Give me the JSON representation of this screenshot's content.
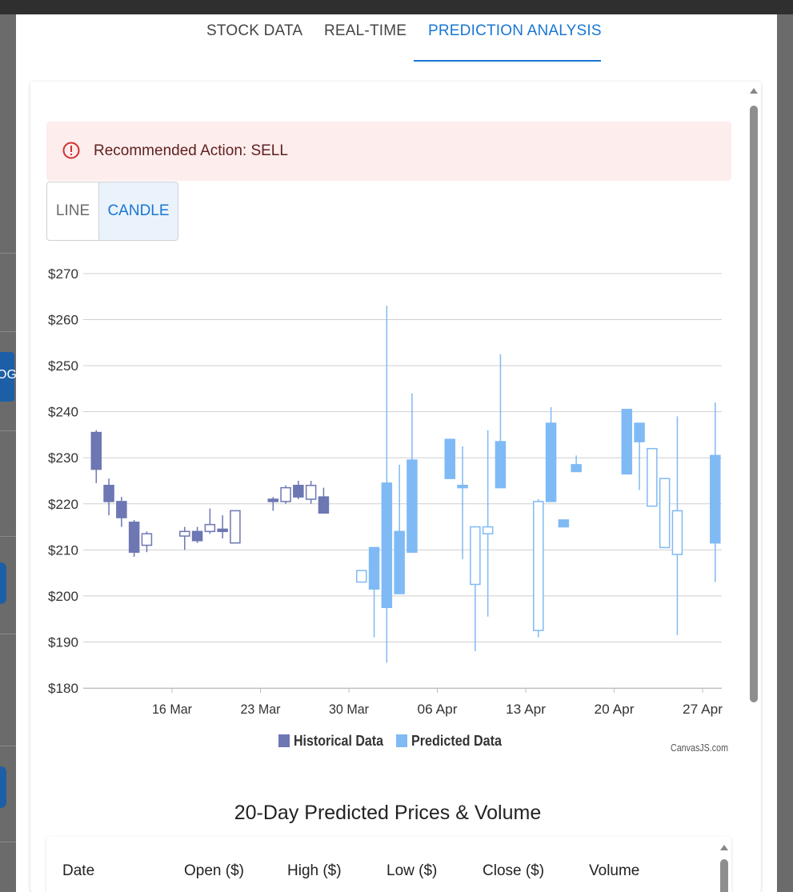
{
  "tabs": [
    {
      "label": "STOCK DATA"
    },
    {
      "label": "REAL-TIME"
    },
    {
      "label": "PREDICTION ANALYSIS"
    }
  ],
  "alert": {
    "text": "Recommended Action: SELL",
    "icon": "error-outline-icon"
  },
  "chart_toggle": {
    "line_label": "LINE",
    "candle_label": "CANDLE",
    "selected": "CANDLE"
  },
  "background": {
    "partial_text": "OG"
  },
  "colors": {
    "historical": "#6d77b3",
    "predicted": "#7fbaf5",
    "accent": "#1976d2",
    "alert_bg": "#fdeded"
  },
  "chart_data": {
    "type": "candlestick",
    "ylim": [
      180,
      270
    ],
    "y_ticks": [
      "$270",
      "$260",
      "$250",
      "$240",
      "$230",
      "$220",
      "$210",
      "$200",
      "$190",
      "$180"
    ],
    "y_tick_values": [
      270,
      260,
      250,
      240,
      230,
      220,
      210,
      200,
      190,
      180
    ],
    "x_ticks": [
      "16 Mar",
      "23 Mar",
      "30 Mar",
      "06 Apr",
      "13 Apr",
      "20 Apr",
      "27 Apr"
    ],
    "x_tick_dates": [
      "2025-03-16",
      "2025-03-23",
      "2025-03-30",
      "2025-04-06",
      "2025-04-13",
      "2025-04-20",
      "2025-04-27"
    ],
    "xlim": [
      "2025-03-09",
      "2025-04-28"
    ],
    "grid": true,
    "legend": "bottom-center",
    "credit": "CanvasJS.com",
    "series": [
      {
        "name": "Historical Data",
        "color": "#6d77b3",
        "points": [
          {
            "date": "2025-03-10",
            "open": 235.5,
            "high": 236,
            "low": 224.5,
            "close": 227.5
          },
          {
            "date": "2025-03-11",
            "open": 224,
            "high": 225.5,
            "low": 217.5,
            "close": 220.5
          },
          {
            "date": "2025-03-12",
            "open": 220.5,
            "high": 221.5,
            "low": 215,
            "close": 217
          },
          {
            "date": "2025-03-13",
            "open": 216,
            "high": 216.5,
            "low": 208.5,
            "close": 209.5
          },
          {
            "date": "2025-03-14",
            "open": 211,
            "high": 214,
            "low": 209.5,
            "close": 213.5
          },
          {
            "date": "2025-03-17",
            "open": 213,
            "high": 215,
            "low": 210,
            "close": 214
          },
          {
            "date": "2025-03-18",
            "open": 214,
            "high": 215,
            "low": 211.5,
            "close": 212
          },
          {
            "date": "2025-03-19",
            "open": 214,
            "high": 219,
            "low": 213.5,
            "close": 215.5
          },
          {
            "date": "2025-03-20",
            "open": 214.5,
            "high": 217.5,
            "low": 212.5,
            "close": 214
          },
          {
            "date": "2025-03-21",
            "open": 211.5,
            "high": 218.5,
            "low": 211.5,
            "close": 218.5
          },
          {
            "date": "2025-03-24",
            "open": 221,
            "high": 221.5,
            "low": 218.5,
            "close": 220.5
          },
          {
            "date": "2025-03-25",
            "open": 220.5,
            "high": 224,
            "low": 220,
            "close": 223.5
          },
          {
            "date": "2025-03-26",
            "open": 224,
            "high": 225,
            "low": 221,
            "close": 221.5
          },
          {
            "date": "2025-03-27",
            "open": 221,
            "high": 225,
            "low": 220,
            "close": 224
          },
          {
            "date": "2025-03-28",
            "open": 221.5,
            "high": 223.5,
            "low": 218,
            "close": 218
          }
        ]
      },
      {
        "name": "Predicted Data",
        "color": "#7fbaf5",
        "points": [
          {
            "date": "2025-03-31",
            "open": 203,
            "high": 205.5,
            "low": 203,
            "close": 205.5
          },
          {
            "date": "2025-04-01",
            "open": 210.5,
            "high": 210.5,
            "low": 191,
            "close": 201.5
          },
          {
            "date": "2025-04-02",
            "open": 224.5,
            "high": 263,
            "low": 185.5,
            "close": 197.5
          },
          {
            "date": "2025-04-03",
            "open": 214,
            "high": 228.5,
            "low": 200.5,
            "close": 200.5
          },
          {
            "date": "2025-04-04",
            "open": 229.5,
            "high": 244,
            "low": 209.5,
            "close": 209.5
          },
          {
            "date": "2025-04-07",
            "open": 234,
            "high": 234,
            "low": 225.5,
            "close": 225.5
          },
          {
            "date": "2025-04-08",
            "open": 224,
            "high": 232.5,
            "low": 208,
            "close": 223.5
          },
          {
            "date": "2025-04-09",
            "open": 202.5,
            "high": 215,
            "low": 188,
            "close": 215
          },
          {
            "date": "2025-04-10",
            "open": 213.5,
            "high": 236,
            "low": 195.5,
            "close": 215
          },
          {
            "date": "2025-04-11",
            "open": 233.5,
            "high": 252.5,
            "low": 223.5,
            "close": 223.5
          },
          {
            "date": "2025-04-14",
            "open": 192.5,
            "high": 221,
            "low": 191,
            "close": 220.5
          },
          {
            "date": "2025-04-15",
            "open": 237.5,
            "high": 241,
            "low": 220.5,
            "close": 220.5
          },
          {
            "date": "2025-04-16",
            "open": 216.5,
            "high": 216.5,
            "low": 215,
            "close": 215
          },
          {
            "date": "2025-04-17",
            "open": 228.5,
            "high": 230.5,
            "low": 227,
            "close": 227
          },
          {
            "date": "2025-04-21",
            "open": 240.5,
            "high": 240.5,
            "low": 226.5,
            "close": 226.5
          },
          {
            "date": "2025-04-22",
            "open": 237.5,
            "high": 237.5,
            "low": 223,
            "close": 233.5
          },
          {
            "date": "2025-04-23",
            "open": 219.5,
            "high": 232,
            "low": 219.5,
            "close": 232
          },
          {
            "date": "2025-04-24",
            "open": 210.5,
            "high": 225.5,
            "low": 210.5,
            "close": 225.5
          },
          {
            "date": "2025-04-25",
            "open": 209,
            "high": 239,
            "low": 191.5,
            "close": 218.5
          },
          {
            "date": "2025-04-28",
            "open": 230.5,
            "high": 242,
            "low": 203,
            "close": 211.5
          }
        ]
      }
    ]
  },
  "table": {
    "title": "20-Day Predicted Prices & Volume",
    "headers": [
      "Date",
      "Open ($)",
      "High ($)",
      "Low ($)",
      "Close ($)",
      "Volume"
    ]
  }
}
